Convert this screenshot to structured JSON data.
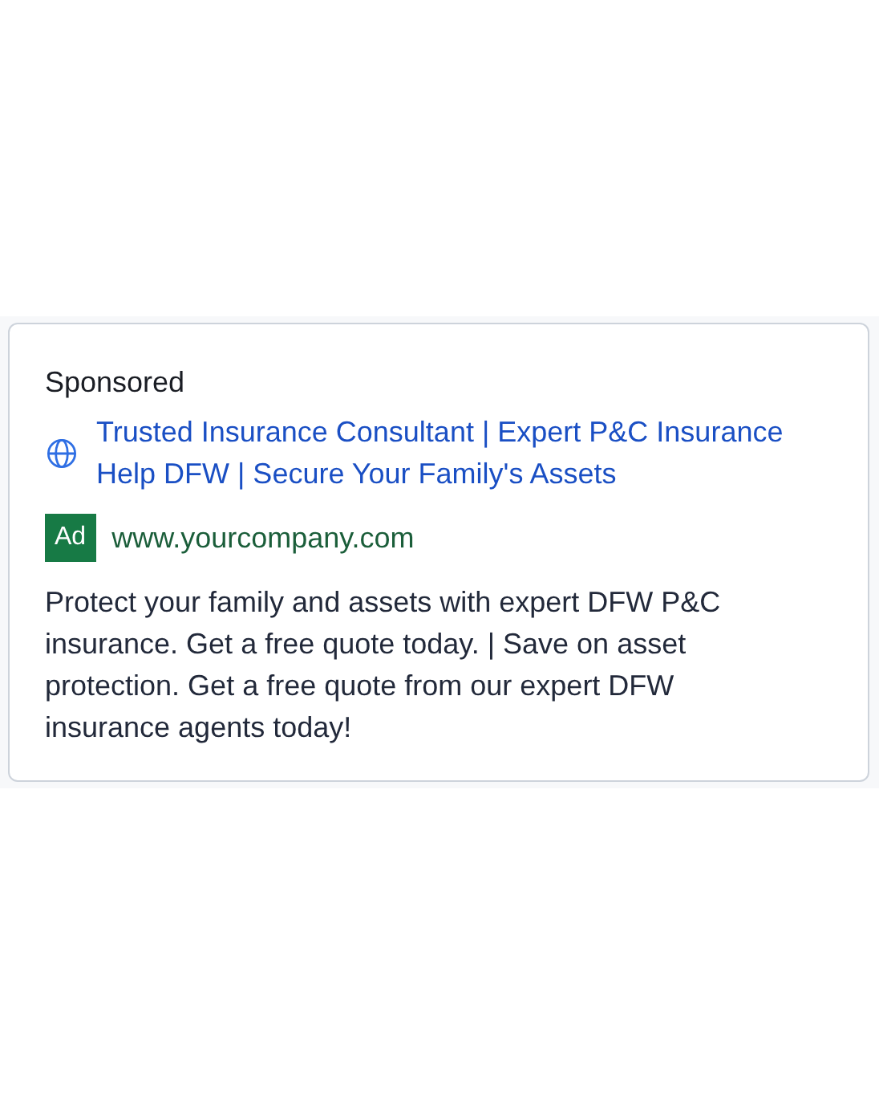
{
  "ad": {
    "label": "Sponsored",
    "headline": "Trusted Insurance Consultant | Expert P&C Insurance Help DFW | Secure Your Family's Assets",
    "badge": "Ad",
    "url": "www.yourcompany.com",
    "description": "Protect your family and assets with expert DFW P&C insurance. Get a free quote today. | Save on asset protection. Get a free quote from our expert DFW insurance agents today!"
  }
}
